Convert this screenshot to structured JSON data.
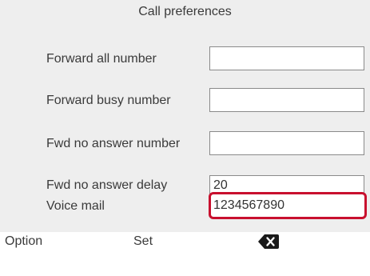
{
  "screen": {
    "title": "Call preferences"
  },
  "fields": [
    {
      "label": "Forward all number",
      "value": ""
    },
    {
      "label": "Forward busy number",
      "value": ""
    },
    {
      "label": "Fwd no answer number",
      "value": ""
    },
    {
      "label": "Fwd no answer delay",
      "value": "20"
    },
    {
      "label": "Voice mail",
      "value": "1234567890"
    }
  ],
  "softkeys": {
    "option_label": "Option",
    "set_label": "Set",
    "backspace_icon": "backspace-icon"
  },
  "colors": {
    "background": "#eeeeee",
    "selection_border": "#c8102e",
    "softkey_bar": "#ffffff"
  }
}
